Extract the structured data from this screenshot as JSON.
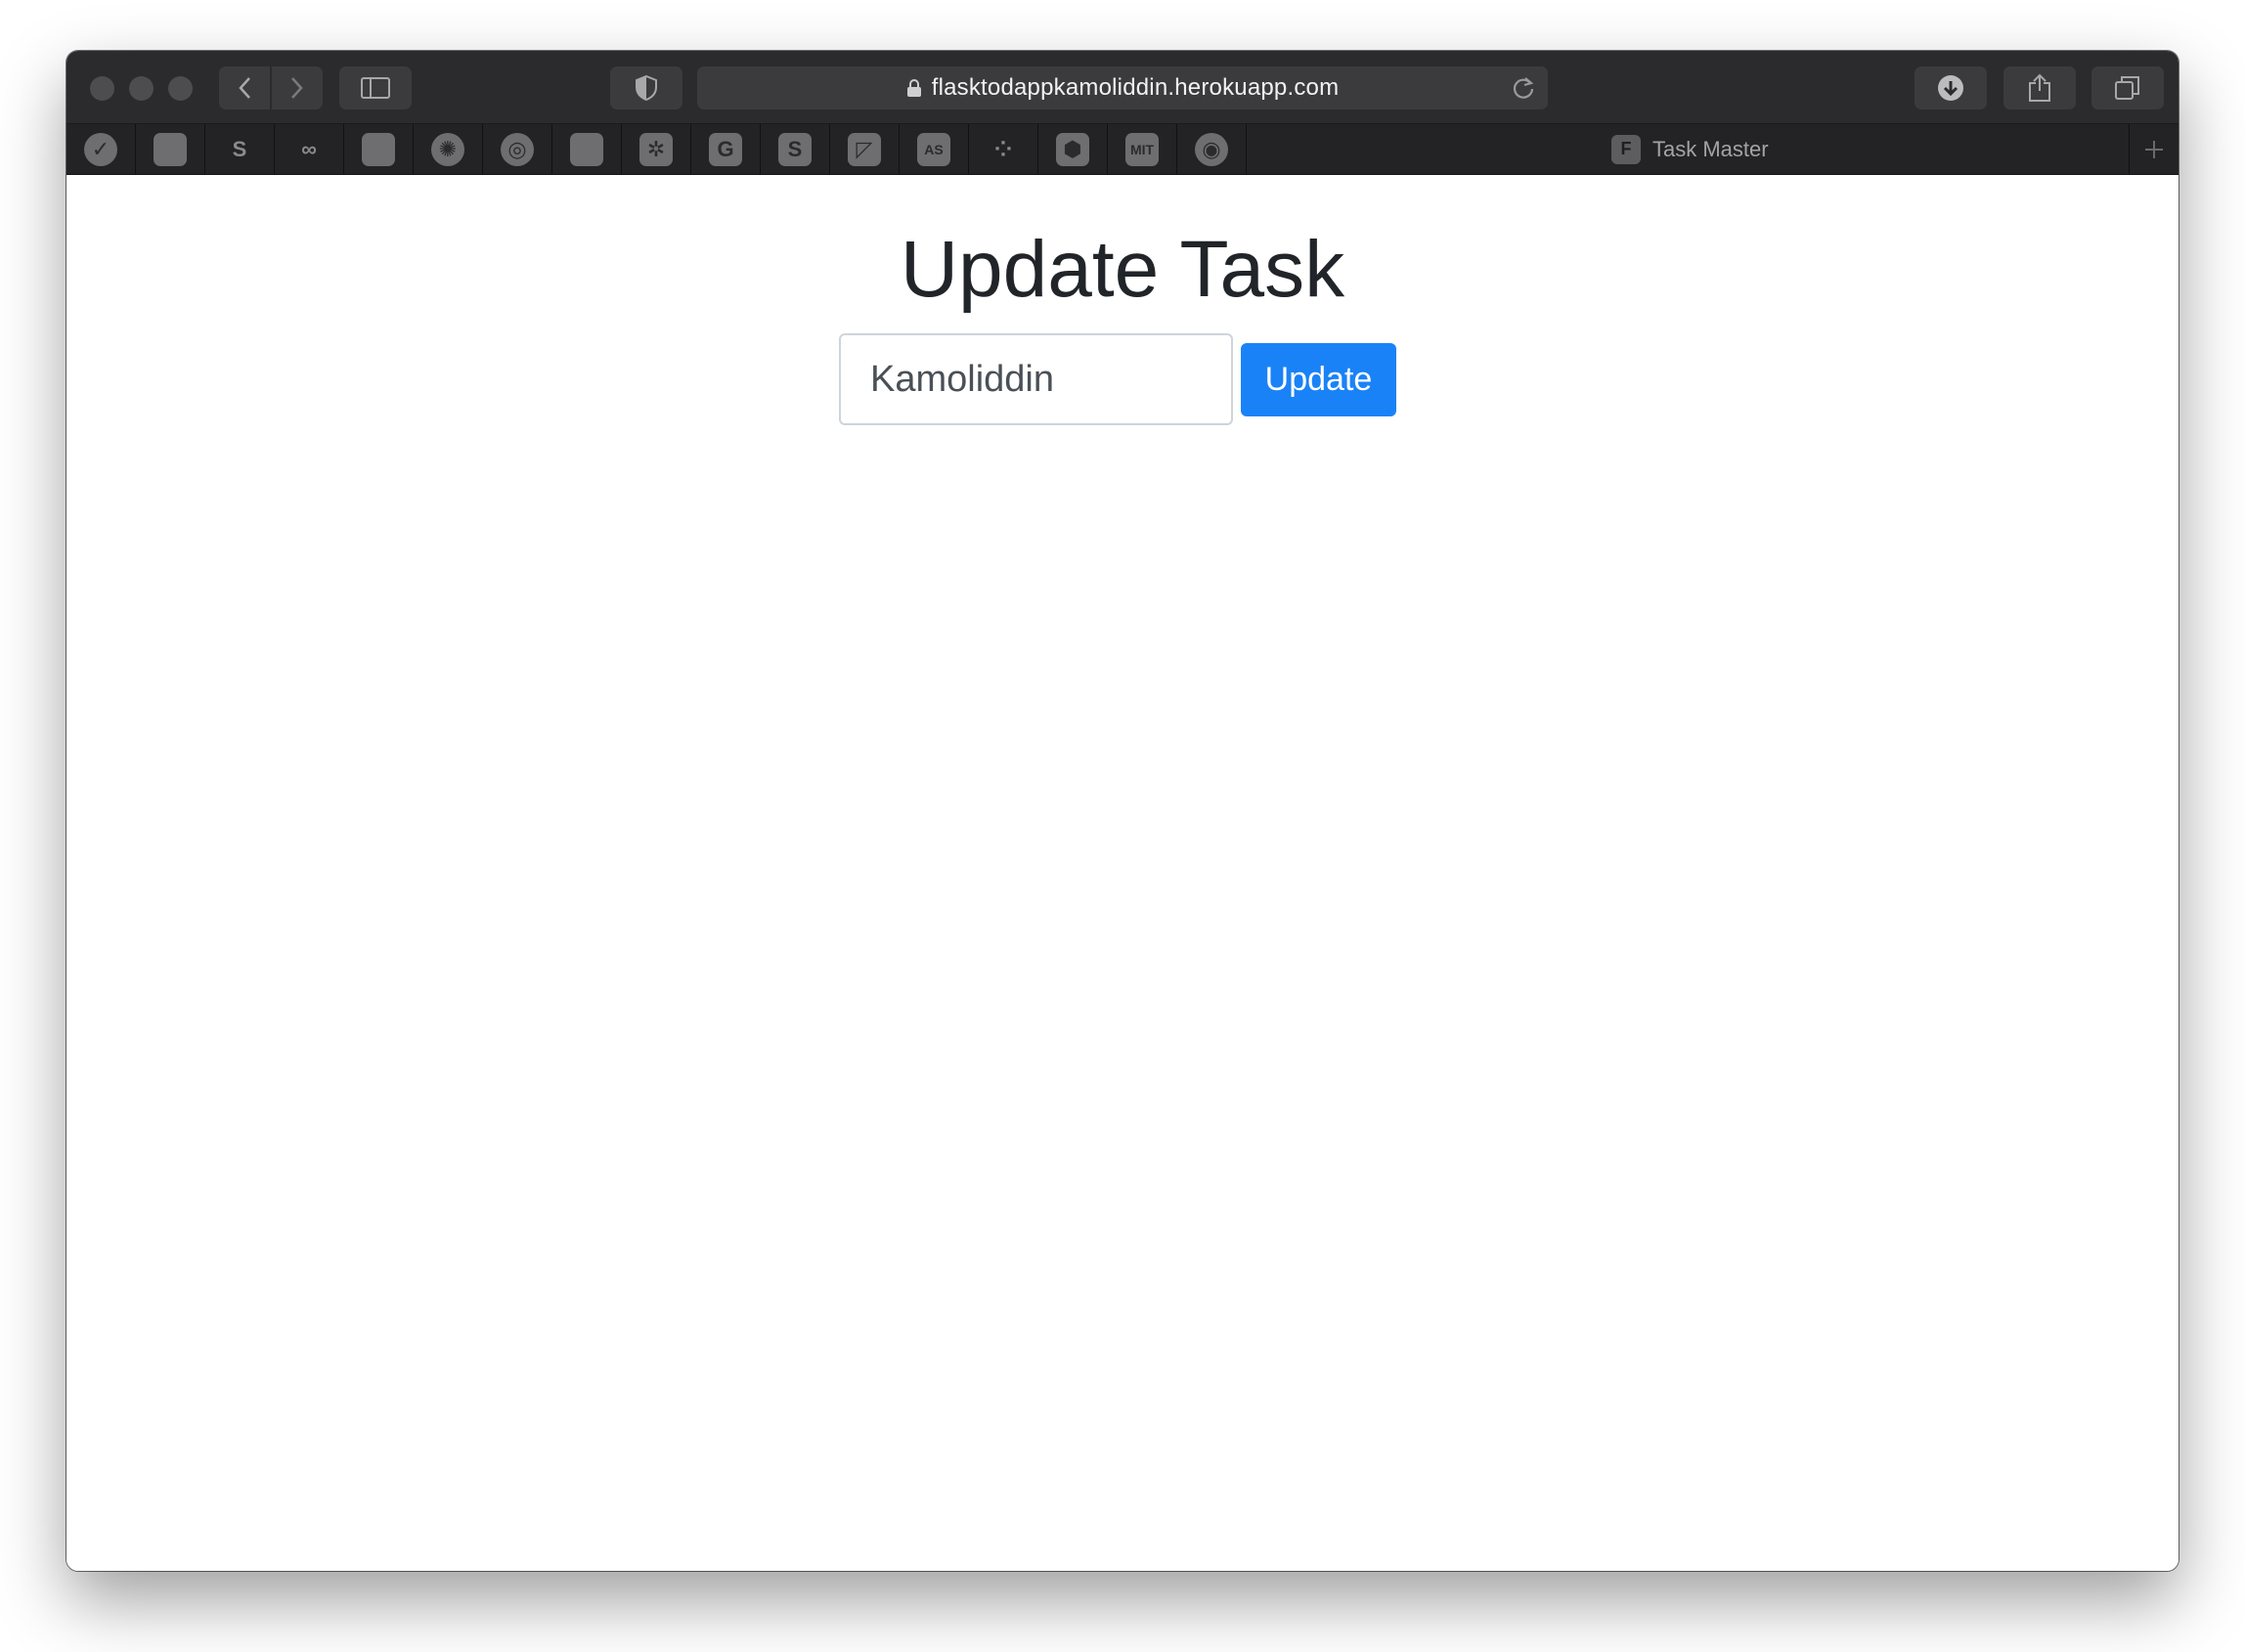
{
  "browser": {
    "url": "flasktodappkamoliddin.herokuapp.com",
    "tab_title": "Task Master",
    "tab_favicon_letter": "F",
    "bookmarks": [
      {
        "name": "checkmark-icon",
        "glyph": "✓"
      },
      {
        "name": "github-icon",
        "glyph": ""
      },
      {
        "name": "strikethrough-icon",
        "glyph": "S"
      },
      {
        "name": "infinity-icon",
        "glyph": "∞"
      },
      {
        "name": "github-icon",
        "glyph": ""
      },
      {
        "name": "openai-icon",
        "glyph": "✺"
      },
      {
        "name": "circle-swirl-icon",
        "glyph": "◎"
      },
      {
        "name": "windows-grid-icon",
        "glyph": ""
      },
      {
        "name": "bee-icon",
        "glyph": "✲"
      },
      {
        "name": "g-letter-icon",
        "glyph": "G"
      },
      {
        "name": "s-letter-icon",
        "glyph": "S"
      },
      {
        "name": "chart-icon",
        "glyph": "◸"
      },
      {
        "name": "as-letters-icon",
        "glyph": "AS"
      },
      {
        "name": "dots-icon",
        "glyph": "⁘"
      },
      {
        "name": "hexagon-icon",
        "glyph": "⬢"
      },
      {
        "name": "mit-ocw-icon",
        "glyph": "MIT"
      },
      {
        "name": "python-icon",
        "glyph": "◉"
      }
    ]
  },
  "page": {
    "title": "Update Task",
    "input_value": "Kamoliddin",
    "button_label": "Update"
  },
  "colors": {
    "accent": "#1a82f7",
    "heading": "#212529",
    "chrome": "#2b2b2d"
  }
}
